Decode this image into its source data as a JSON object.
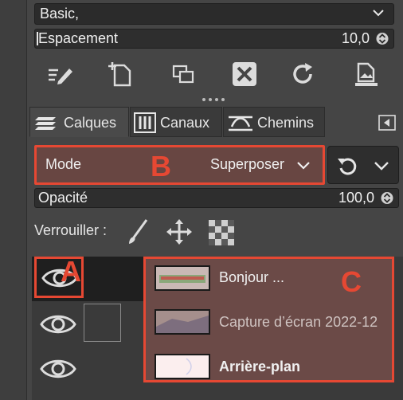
{
  "brush": {
    "preset": "Basic,"
  },
  "spacing": {
    "label": "Espacement",
    "value": "10,0"
  },
  "tabs": [
    {
      "label": "Calques",
      "icon": "layers-icon"
    },
    {
      "label": "Canaux",
      "icon": "channels-icon"
    },
    {
      "label": "Chemins",
      "icon": "paths-icon"
    }
  ],
  "mode": {
    "label": "Mode",
    "value": "Superposer"
  },
  "opacity": {
    "label": "Opacité",
    "value": "100,0"
  },
  "lock": {
    "label": "Verrouiller :"
  },
  "layers": [
    {
      "name": "Bonjour ...",
      "visible": true
    },
    {
      "name": "Capture d’écran 2022-12",
      "visible": true
    },
    {
      "name": "Arrière-plan",
      "visible": true
    }
  ],
  "annotations": {
    "a": "A",
    "b": "B",
    "c": "C"
  },
  "colors": {
    "annotation": "#e64833",
    "selection": "#6b4a47"
  }
}
